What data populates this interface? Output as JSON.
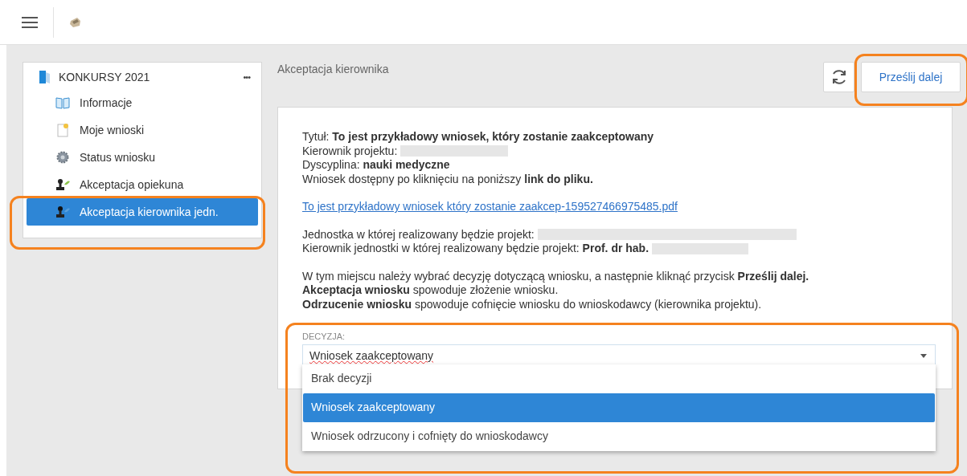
{
  "sidebar": {
    "title": "KONKURSY 2021",
    "more": "•••",
    "items": [
      {
        "label": "Informacje",
        "kind": "book",
        "selected": false
      },
      {
        "label": "Moje wnioski",
        "kind": "document",
        "selected": false
      },
      {
        "label": "Status wniosku",
        "kind": "gear",
        "selected": false
      },
      {
        "label": "Akceptacja opiekuna",
        "kind": "stamp",
        "selected": false
      },
      {
        "label": "Akceptacja kierownika jedn.",
        "kind": "stamp",
        "selected": true
      }
    ]
  },
  "page": {
    "title": "Akceptacja kierownika",
    "submit_button": "Prześlij dalej",
    "details": [
      {
        "kind": "text",
        "text": "Tytuł: **To jest przykładowy wniosek, który zostanie zaakceptowany**"
      },
      {
        "kind": "redacted",
        "text": "Kierownik projektu:"
      },
      {
        "kind": "text",
        "text": "Dyscyplina: **nauki medyczne**"
      },
      {
        "kind": "text",
        "text": "Wniosek dostępny po kliknięciu na poniższy **link do pliku.**"
      },
      {
        "kind": "gap"
      },
      {
        "kind": "link",
        "text": "To jest przykładowy wniosek który zostanie zaakcep-159527466975485.pdf"
      },
      {
        "kind": "gap"
      },
      {
        "kind": "redacted",
        "text": "Jednostka w której realizowany będzie projekt:"
      },
      {
        "kind": "redacted",
        "text": "Kierownik jednostki w której realizowany będzie projekt: **Prof. dr hab.**"
      },
      {
        "kind": "gap"
      },
      {
        "kind": "text",
        "text": "W tym miejscu należy wybrać decyzję dotyczącą wniosku, a następnie kliknąć przycisk **Prześlij dalej.**"
      },
      {
        "kind": "text",
        "text": "**Akceptacja wniosku** spowoduje złożenie wniosku."
      },
      {
        "kind": "text",
        "text": "**Odrzucenie wniosku** spowoduje cofnięcie wniosku do wnioskodawcy (kierownika projektu)."
      }
    ],
    "decision": {
      "label": "DECYZJA:",
      "value": "Wniosek zaakceptowany",
      "options": [
        {
          "label": "Brak decyzji",
          "selected": false
        },
        {
          "label": "Wniosek zaakceptowany",
          "selected": true
        },
        {
          "label": "Wniosek odrzucony i cofnięty do wnioskodawcy",
          "selected": false
        }
      ]
    }
  }
}
